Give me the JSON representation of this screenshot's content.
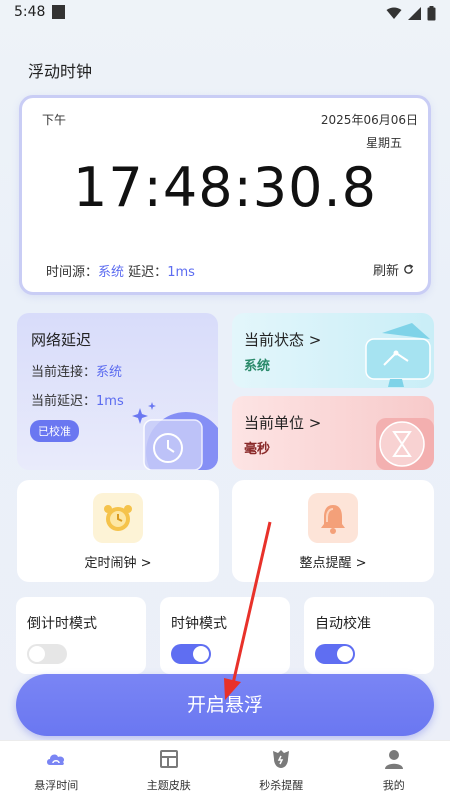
{
  "status_bar": {
    "time": "5:48"
  },
  "page_title": "浮动时钟",
  "clock": {
    "ampm": "下午",
    "date": "2025年06月06日",
    "weekday": "星期五",
    "time": "17:48:30.8",
    "source_label": "时间源：",
    "source_value": "系统",
    "delay_label": "延迟：",
    "delay_value": "1ms",
    "refresh_label": "刷新"
  },
  "network": {
    "title": "网络延迟",
    "connection_label": "当前连接：",
    "connection_value": "系统",
    "delay_label": "当前延迟：",
    "delay_value": "1ms",
    "badge": "已校准"
  },
  "status_card": {
    "title": "当前状态 >",
    "value": "系统"
  },
  "unit_card": {
    "title": "当前单位 >",
    "value": "毫秒"
  },
  "features": {
    "alarm_label": "定时闹钟 >",
    "hourly_label": "整点提醒 >"
  },
  "modes": {
    "countdown": {
      "label": "倒计时模式",
      "on": false
    },
    "clock": {
      "label": "时钟模式",
      "on": true
    },
    "auto_calibrate": {
      "label": "自动校准",
      "on": true
    }
  },
  "main_button": "开启悬浮",
  "nav": [
    {
      "label": "悬浮时间",
      "icon": "cloud-icon",
      "active": true
    },
    {
      "label": "主题皮肤",
      "icon": "layout-icon",
      "active": false
    },
    {
      "label": "秒杀提醒",
      "icon": "alarm-icon",
      "active": false
    },
    {
      "label": "我的",
      "icon": "user-icon",
      "active": false
    }
  ],
  "colors": {
    "accent": "#6a77f1",
    "link": "#5c6cf0",
    "arrow": "#e8312a"
  }
}
